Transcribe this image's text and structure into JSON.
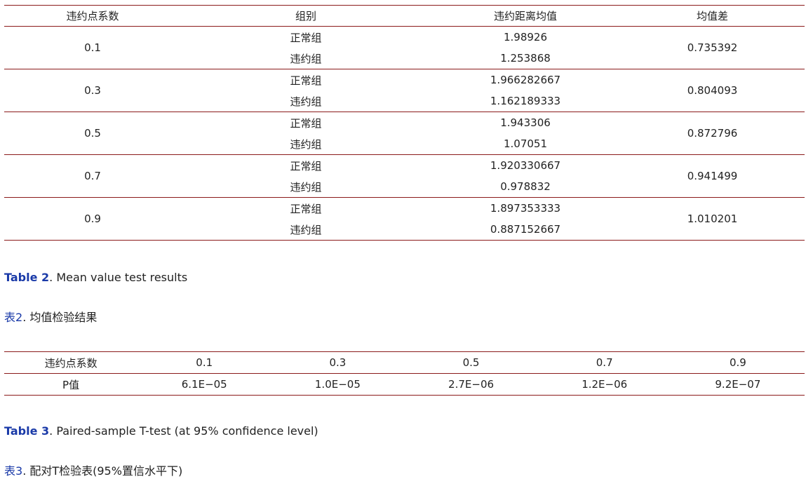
{
  "table2": {
    "headers": [
      "违约点系数",
      "组别",
      "违约距离均值",
      "均值差"
    ],
    "groups": [
      {
        "coef": "0.1",
        "normal_label": "正常组",
        "normal_value": "1.98926",
        "default_label": "违约组",
        "default_value": "1.253868",
        "diff": "0.735392"
      },
      {
        "coef": "0.3",
        "normal_label": "正常组",
        "normal_value": "1.966282667",
        "default_label": "违约组",
        "default_value": "1.162189333",
        "diff": "0.804093"
      },
      {
        "coef": "0.5",
        "normal_label": "正常组",
        "normal_value": "1.943306",
        "default_label": "违约组",
        "default_value": "1.07051",
        "diff": "0.872796"
      },
      {
        "coef": "0.7",
        "normal_label": "正常组",
        "normal_value": "1.920330667",
        "default_label": "违约组",
        "default_value": "0.978832",
        "diff": "0.941499"
      },
      {
        "coef": "0.9",
        "normal_label": "正常组",
        "normal_value": "1.897353333",
        "default_label": "违约组",
        "default_value": "0.887152667",
        "diff": "1.010201"
      }
    ],
    "caption_en_label": "Table 2",
    "caption_en_text": ". Mean value test results",
    "caption_cn_label": "表2",
    "caption_cn_text": ". 均值检验结果"
  },
  "table3": {
    "header_row": [
      "违约点系数",
      "0.1",
      "0.3",
      "0.5",
      "0.7",
      "0.9"
    ],
    "value_row": [
      "P值",
      "6.1E−05",
      "1.0E−05",
      "2.7E−06",
      "1.2E−06",
      "9.2E−07"
    ],
    "caption_en_label": "Table 3",
    "caption_en_text": ". Paired-sample T-test (at 95% confidence level)",
    "caption_cn_label": "表3",
    "caption_cn_text": ". 配对T检验表(95%置信水平下)"
  },
  "colors": {
    "rule": "#8b1a1a",
    "label_blue": "#1a3aa8",
    "text": "#222222"
  }
}
